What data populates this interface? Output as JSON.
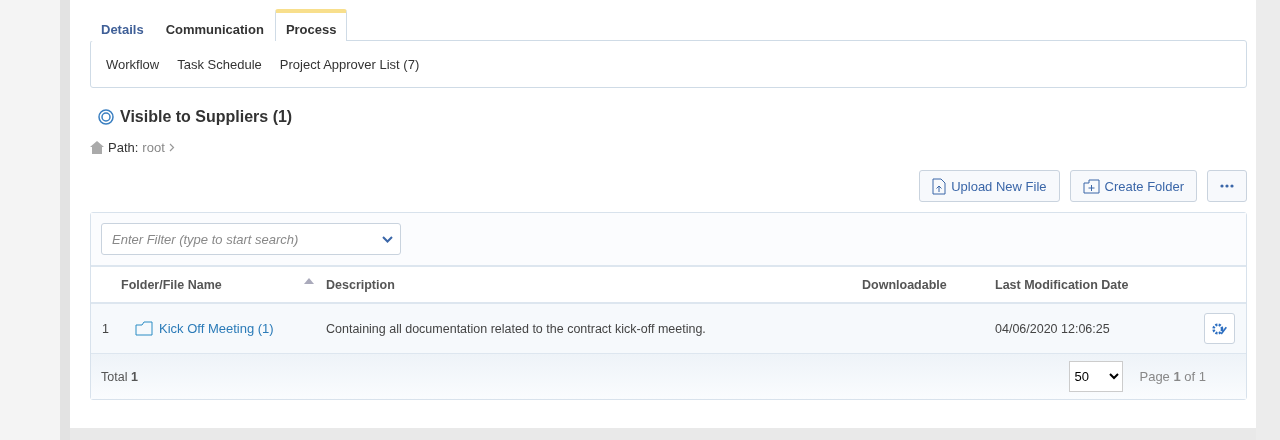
{
  "tabs": [
    {
      "label": "Details",
      "selected": false
    },
    {
      "label": "Communication",
      "selected": false
    },
    {
      "label": "Process",
      "selected": true
    }
  ],
  "subtabs": [
    "Workflow",
    "Task Schedule",
    "Project Approver List (7)"
  ],
  "heading": "Visible to Suppliers (1)",
  "path": {
    "label": "Path:",
    "crumb": "root"
  },
  "actions": [
    "Upload New File",
    "Create Folder"
  ],
  "filter": {
    "placeholder": "Enter Filter (type to start search)"
  },
  "table": {
    "columns": [
      {
        "label": "Folder/File Name",
        "sorted": true
      },
      {
        "label": "Description",
        "sorted": false
      },
      {
        "label": "Downloadable",
        "sorted": false
      },
      {
        "label": "Last Modification Date",
        "sorted": false
      }
    ],
    "rows": [
      {
        "index": "1",
        "name": "Kick Off Meeting (1)",
        "description": "Containing all documentation related to the contract kick-off meeting.",
        "downloadable": "",
        "modified": "04/06/2020 12:06:25"
      }
    ]
  },
  "footer": {
    "total": "Total **1**",
    "page_size": "50",
    "page": "Page **1** of 1"
  }
}
